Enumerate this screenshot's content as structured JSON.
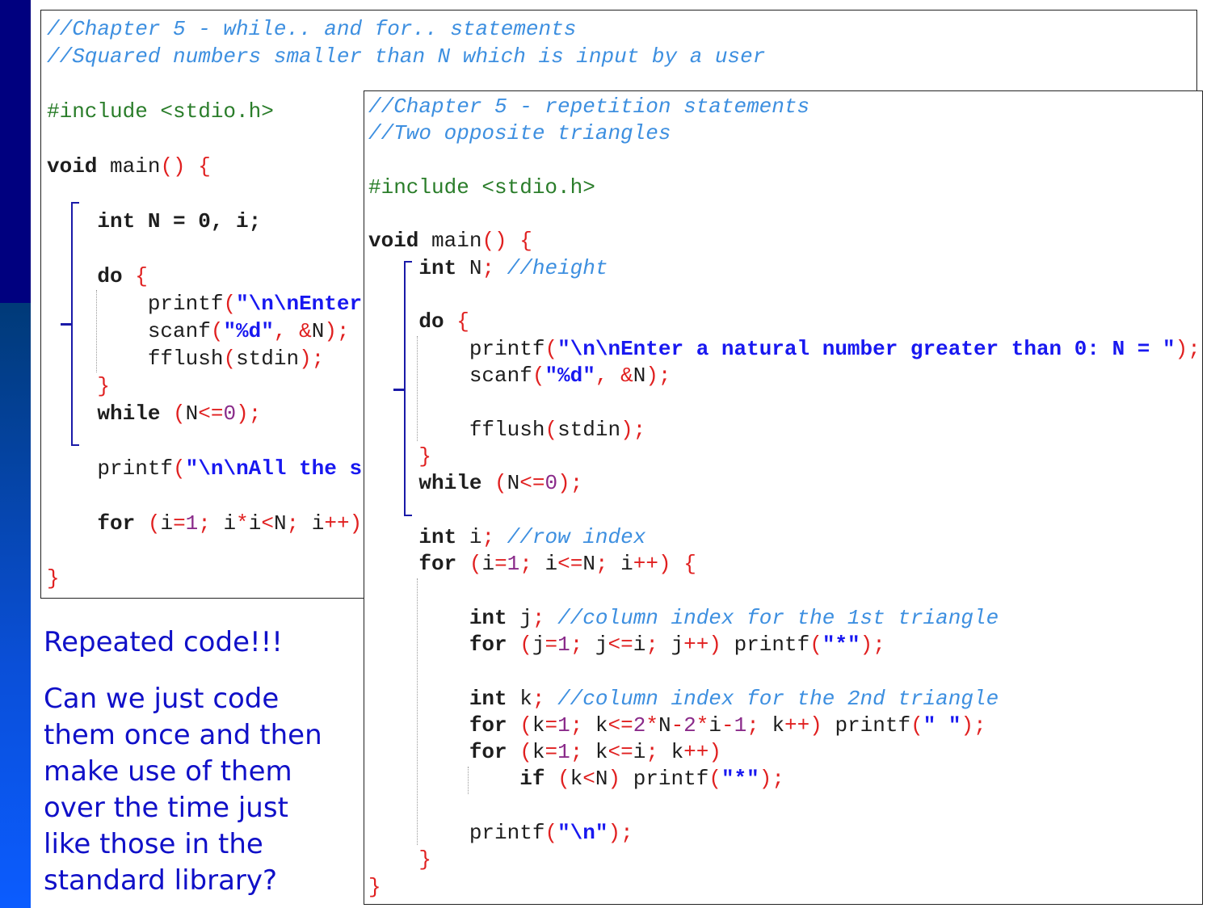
{
  "left_code": {
    "lines": [
      "//Chapter 5 - while.. and for.. statements",
      "//Squared numbers smaller than N which is input by a user",
      "",
      "#include <stdio.h>",
      "",
      "void main() {",
      "",
      "    int N = 0, i;",
      "",
      "    do {",
      "        printf(\"\\n\\nEnter",
      "        scanf(\"%d\", &N);",
      "        fflush(stdin);",
      "    }",
      "    while (N<=0);",
      "",
      "    printf(\"\\n\\nAll the s",
      "",
      "    for (i=1; i*i<N; i++)",
      "",
      "}"
    ]
  },
  "right_code": {
    "lines": [
      "//Chapter 5 - repetition statements",
      "//Two opposite triangles",
      "",
      "#include <stdio.h>",
      "",
      "void main() {",
      "    int N; //height",
      "",
      "    do {",
      "        printf(\"\\n\\nEnter a natural number greater than 0: N = \");",
      "        scanf(\"%d\", &N);",
      "",
      "        fflush(stdin);",
      "    }",
      "    while (N<=0);",
      "",
      "    int i; //row index",
      "    for (i=1; i<=N; i++) {",
      "",
      "        int j; //column index for the 1st triangle",
      "        for (j=1; j<=i; j++) printf(\"*\");",
      "",
      "        int k; //column index for the 2nd triangle",
      "        for (k=1; k<=2*N-2*i-1; k++) printf(\" \");",
      "        for (k=1; k<=i; k++)",
      "            if (k<N) printf(\"*\");",
      "",
      "        printf(\"\\n\");",
      "    }",
      "}"
    ]
  },
  "slide": {
    "heading": "Repeated code!!!",
    "question_lines": [
      "Can we just code",
      "them once and then",
      "make use of them",
      "over the time just",
      "like those in the",
      "standard library?"
    ]
  },
  "colors": {
    "comment": "#3d8fe0",
    "string": "#1818f0",
    "punctuation": "#e02020",
    "number": "#8a2b8a",
    "preprocessor": "#2a7d2a",
    "slide_text": "#1010c8",
    "sidebar_dark": "#00007f",
    "sidebar_bright": "#0b5cff",
    "bracket": "#1a1aa8"
  }
}
